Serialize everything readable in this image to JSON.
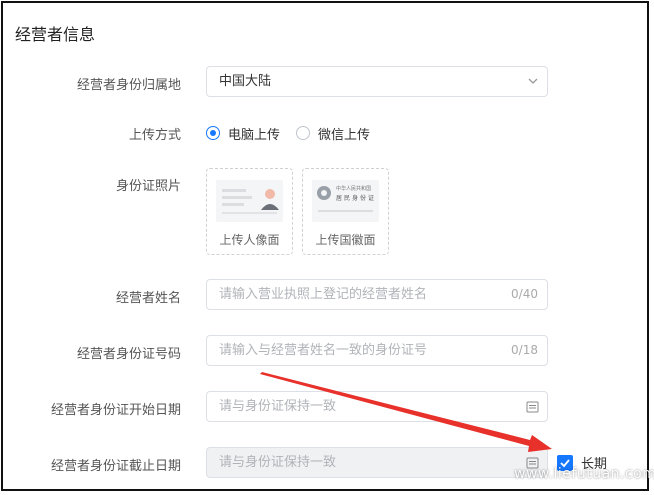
{
  "section_title": "经营者信息",
  "fields": {
    "region": {
      "label": "经营者身份归属地",
      "value": "中国大陆"
    },
    "upload_method": {
      "label": "上传方式",
      "options": [
        "电脑上传",
        "微信上传"
      ],
      "selected": "电脑上传"
    },
    "id_photo": {
      "label": "身份证照片",
      "front_caption": "上传人像面",
      "back_caption": "上传国徽面",
      "back_card_line1": "中华人民共和国",
      "back_card_line2": "居民身份证"
    },
    "name": {
      "label": "经营者姓名",
      "placeholder": "请输入营业执照上登记的经营者姓名",
      "counter": "0/40"
    },
    "id_number": {
      "label": "经营者身份证号码",
      "placeholder": "请输入与经营者姓名一致的身份证号",
      "counter": "0/18"
    },
    "start_date": {
      "label": "经营者身份证开始日期",
      "placeholder": "请与身份证保持一致"
    },
    "end_date": {
      "label": "经营者身份证截止日期",
      "placeholder": "请与身份证保持一致",
      "long_term_label": "长期",
      "long_term_checked": true
    }
  },
  "watermark": "www.liefutuan.com",
  "colors": {
    "accent": "#1677ff",
    "annotation_arrow": "#e8312a"
  }
}
